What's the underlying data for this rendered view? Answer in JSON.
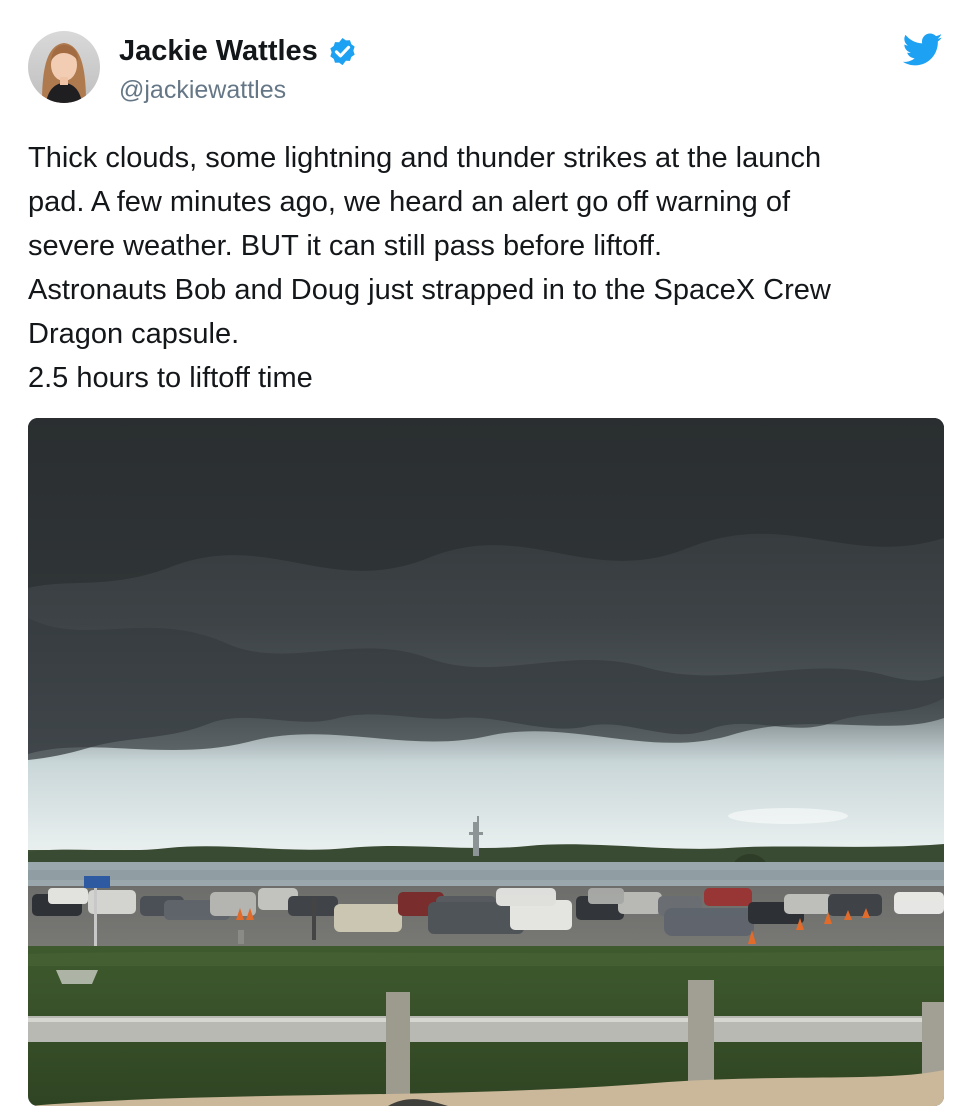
{
  "tweet": {
    "author": {
      "display_name": "Jackie Wattles",
      "handle": "@jackiewattles",
      "verified": true,
      "avatar_icon": "profile-photo"
    },
    "brand": {
      "icon": "twitter-bird-icon",
      "color": "#1da1f2"
    },
    "text_lines": [
      "Thick clouds, some lightning and thunder strikes at the launch",
      "pad. A few minutes ago, we heard an alert go off warning of",
      "severe weather. BUT it can still pass before liftoff.",
      "Astronauts Bob and Doug just strapped in to the SpaceX Crew",
      "Dragon capsule.",
      "2.5 hours to liftoff time"
    ],
    "media": {
      "kind": "photo"
    }
  },
  "colors": {
    "text": "#14171a",
    "secondary_text": "#657786",
    "verified_badge": "#1da1f2"
  }
}
